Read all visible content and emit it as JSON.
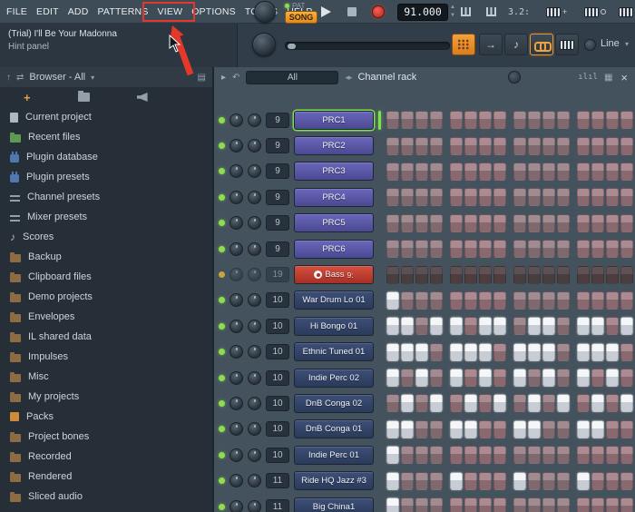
{
  "colors": {
    "annotation_red": "#e5382b",
    "accent_orange": "#f0a23c",
    "selected_green": "#7de24a",
    "led_green": "#8ede4b"
  },
  "menu_bar": {
    "items": [
      "FILE",
      "EDIT",
      "ADD",
      "PATTERNS",
      "VIEW",
      "OPTIONS",
      "TOOLS",
      "HELP"
    ],
    "highlighted_item": "OPTIONS"
  },
  "transport": {
    "pat_label": "PAT",
    "song_label": "SONG",
    "active_mode": "SONG",
    "tempo": "91.000"
  },
  "top_right": {
    "counter": "3.2:"
  },
  "hint_panel": {
    "title": "(Trial) I'll Be Your Madonna",
    "subtitle": "Hint panel"
  },
  "snap": {
    "label": "Line"
  },
  "browser": {
    "header": "Browser - All",
    "items": [
      {
        "label": "Current project",
        "icon": "file",
        "color": "#aeb8c0"
      },
      {
        "label": "Recent files",
        "icon": "folder",
        "color": "#5e9a52"
      },
      {
        "label": "Plugin database",
        "icon": "plug",
        "color": "#4d79b0"
      },
      {
        "label": "Plugin presets",
        "icon": "plug",
        "color": "#4d79b0"
      },
      {
        "label": "Channel presets",
        "icon": "sliders",
        "color": "#93a0aa"
      },
      {
        "label": "Mixer presets",
        "icon": "sliders",
        "color": "#93a0aa"
      },
      {
        "label": "Scores",
        "icon": "note",
        "color": "#aeb8c0"
      },
      {
        "label": "Backup",
        "icon": "folder",
        "color": "#8d6b43"
      },
      {
        "label": "Clipboard files",
        "icon": "folder",
        "color": "#8d6b43"
      },
      {
        "label": "Demo projects",
        "icon": "folder",
        "color": "#8d6b43"
      },
      {
        "label": "Envelopes",
        "icon": "folder",
        "color": "#8d6b43"
      },
      {
        "label": "IL shared data",
        "icon": "folder",
        "color": "#8d6b43"
      },
      {
        "label": "Impulses",
        "icon": "folder",
        "color": "#8d6b43"
      },
      {
        "label": "Misc",
        "icon": "folder",
        "color": "#8d6b43"
      },
      {
        "label": "My projects",
        "icon": "folder",
        "color": "#8d6b43"
      },
      {
        "label": "Packs",
        "icon": "box",
        "color": "#cf8b3a"
      },
      {
        "label": "Project bones",
        "icon": "folder",
        "color": "#8d6b43"
      },
      {
        "label": "Recorded",
        "icon": "folder",
        "color": "#8d6b43"
      },
      {
        "label": "Rendered",
        "icon": "folder",
        "color": "#8d6b43"
      },
      {
        "label": "Sliced audio",
        "icon": "folder",
        "color": "#8d6b43"
      }
    ]
  },
  "channel_rack": {
    "filter_label": "All",
    "title": "Channel rack",
    "channels": [
      {
        "name": "PRC1",
        "track": "9",
        "color": "purple",
        "selected": true,
        "steps": [
          0,
          0,
          0,
          0,
          0,
          0,
          0,
          0,
          0,
          0,
          0,
          0,
          0,
          0,
          0,
          0
        ]
      },
      {
        "name": "PRC2",
        "track": "9",
        "color": "purple",
        "steps": [
          0,
          0,
          0,
          0,
          0,
          0,
          0,
          0,
          0,
          0,
          0,
          0,
          0,
          0,
          0,
          0
        ]
      },
      {
        "name": "PRC3",
        "track": "9",
        "color": "purple",
        "steps": [
          0,
          0,
          0,
          0,
          0,
          0,
          0,
          0,
          0,
          0,
          0,
          0,
          0,
          0,
          0,
          0
        ]
      },
      {
        "name": "PRC4",
        "track": "9",
        "color": "purple",
        "steps": [
          0,
          0,
          0,
          0,
          0,
          0,
          0,
          0,
          0,
          0,
          0,
          0,
          0,
          0,
          0,
          0
        ]
      },
      {
        "name": "PRC5",
        "track": "9",
        "color": "purple",
        "steps": [
          0,
          0,
          0,
          0,
          0,
          0,
          0,
          0,
          0,
          0,
          0,
          0,
          0,
          0,
          0,
          0
        ]
      },
      {
        "name": "PRC6",
        "track": "9",
        "color": "purple",
        "steps": [
          0,
          0,
          0,
          0,
          0,
          0,
          0,
          0,
          0,
          0,
          0,
          0,
          0,
          0,
          0,
          0
        ]
      },
      {
        "name": "Bass",
        "track": "19",
        "color": "red",
        "dim": true,
        "icon": "mute-circle",
        "badge": "9:",
        "steps": [
          0,
          0,
          0,
          0,
          0,
          0,
          0,
          0,
          0,
          0,
          0,
          0,
          0,
          0,
          0,
          0
        ]
      },
      {
        "name": "War Drum Lo 01",
        "track": "10",
        "color": "navy",
        "steps": [
          1,
          0,
          0,
          0,
          0,
          0,
          0,
          0,
          0,
          0,
          0,
          0,
          0,
          0,
          0,
          0
        ]
      },
      {
        "name": "Hi Bongo 01",
        "track": "10",
        "color": "navy",
        "steps": [
          1,
          1,
          0,
          1,
          1,
          0,
          1,
          1,
          0,
          1,
          1,
          0,
          1,
          1,
          0,
          1
        ]
      },
      {
        "name": "Ethnic Tuned 01",
        "track": "10",
        "color": "navy",
        "steps": [
          1,
          1,
          1,
          0,
          1,
          1,
          1,
          0,
          1,
          1,
          1,
          0,
          1,
          1,
          1,
          0
        ]
      },
      {
        "name": "Indie Perc 02",
        "track": "10",
        "color": "navy",
        "steps": [
          1,
          0,
          1,
          0,
          1,
          0,
          1,
          0,
          1,
          0,
          1,
          0,
          1,
          0,
          1,
          0
        ]
      },
      {
        "name": "DnB Conga 02",
        "track": "10",
        "color": "navy",
        "steps": [
          0,
          1,
          0,
          1,
          0,
          1,
          0,
          1,
          0,
          1,
          0,
          1,
          0,
          1,
          0,
          1
        ]
      },
      {
        "name": "DnB Conga 01",
        "track": "10",
        "color": "navy",
        "steps": [
          1,
          1,
          0,
          0,
          1,
          1,
          0,
          0,
          1,
          1,
          0,
          0,
          1,
          1,
          0,
          0
        ]
      },
      {
        "name": "Indie Perc 01",
        "track": "10",
        "color": "navy",
        "steps": [
          1,
          0,
          0,
          0,
          0,
          0,
          0,
          0,
          0,
          0,
          0,
          0,
          0,
          0,
          0,
          0
        ]
      },
      {
        "name": "Ride HQ Jazz #3",
        "track": "11",
        "color": "navy",
        "steps": [
          1,
          0,
          0,
          0,
          1,
          0,
          0,
          0,
          1,
          0,
          0,
          0,
          1,
          0,
          0,
          0
        ]
      },
      {
        "name": "Big China1",
        "track": "11",
        "color": "navy",
        "steps": [
          1,
          0,
          0,
          0,
          0,
          0,
          0,
          0,
          0,
          0,
          0,
          0,
          0,
          0,
          0,
          0
        ]
      }
    ]
  }
}
